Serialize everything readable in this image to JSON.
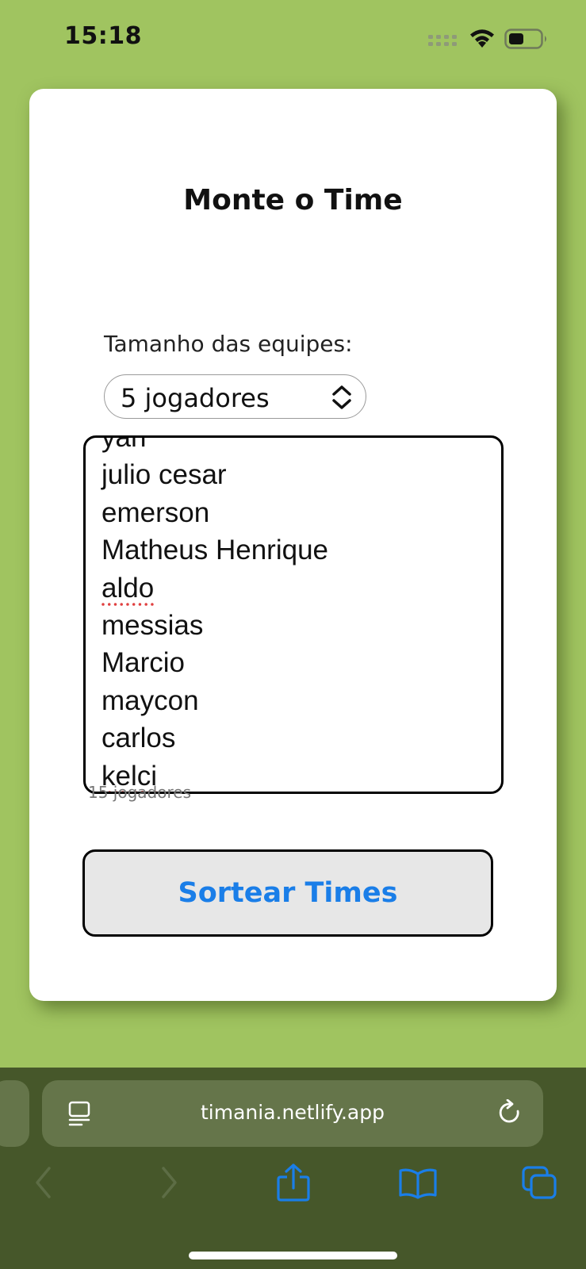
{
  "status_bar": {
    "time": "15:18"
  },
  "app": {
    "title": "Monte o Time",
    "team_size_label": "Tamanho das equipes:",
    "team_size_selected": "5 jogadores",
    "players": [
      "yan",
      "julio cesar",
      "emerson",
      "Matheus Henrique",
      "aldo",
      "messias",
      "Marcio",
      "maycon",
      "carlos",
      "kelci"
    ],
    "players_count": "15 jogadores",
    "sort_button_label": "Sortear Times"
  },
  "browser": {
    "url": "timania.netlify.app"
  },
  "colors": {
    "background": "#a0c460",
    "accent_blue": "#1a7ee8",
    "browser_toolbar": "#46572a"
  },
  "icons": [
    "signal-icon",
    "wifi-icon",
    "battery-icon",
    "chevron-updown-icon",
    "page-menu-icon",
    "reload-icon",
    "back-icon",
    "forward-icon",
    "share-icon",
    "bookmarks-icon",
    "tabs-icon"
  ]
}
